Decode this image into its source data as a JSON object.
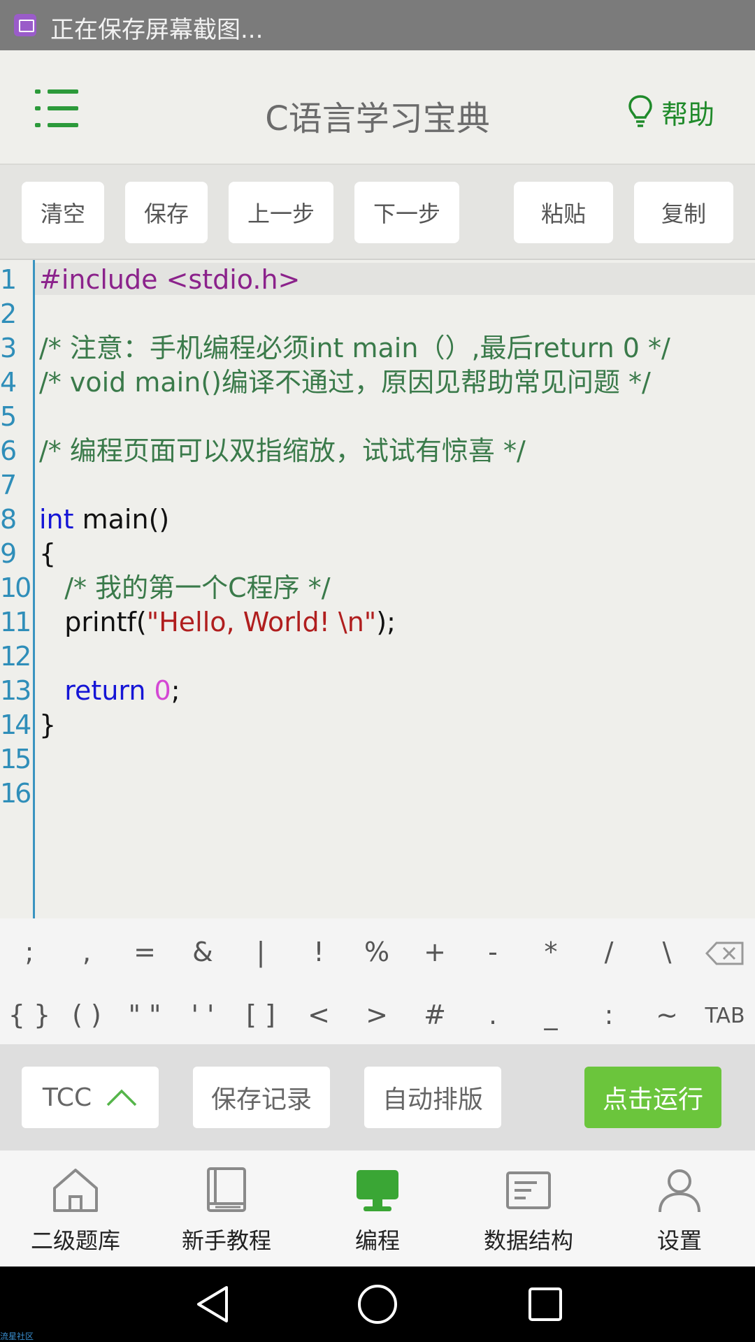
{
  "status_bar": {
    "notification": "正在保存屏幕截图..."
  },
  "header": {
    "title": "C语言学习宝典",
    "help_label": "帮助"
  },
  "toolbar": {
    "clear": "清空",
    "save": "保存",
    "undo": "上一步",
    "redo": "下一步",
    "paste": "粘贴",
    "copy": "复制"
  },
  "editor": {
    "line_numbers": [
      "1",
      "2",
      "3",
      "4",
      "5",
      "6",
      "7",
      "8",
      "9",
      "10",
      "11",
      "12",
      "13",
      "14",
      "15",
      "16"
    ],
    "line1": "#include <stdio.h>",
    "line3": "/* 注意：手机编程必须int main（）,最后return 0 */",
    "line4": "/* void main()编译不通过，原因见帮助常见问题 */",
    "line6": "/* 编程页面可以双指缩放，试试有惊喜 */",
    "line8_kw": "int",
    "line8_rest": " main()",
    "line9": "{",
    "line10_indent": "   ",
    "line10": "/* 我的第一个C程序 */",
    "line11_fn": "   printf(",
    "line11_str": "\"Hello, World! \\n\"",
    "line11_end": ");",
    "line13_indent": "   ",
    "line13_kw": "return",
    "line13_sp": " ",
    "line13_num": "0",
    "line13_end": ";",
    "line14": "}"
  },
  "symbol_keys": {
    "row1": [
      ";",
      ",",
      "=",
      "&",
      "|",
      "!",
      "%",
      "+",
      "-",
      "*",
      "/",
      "\\"
    ],
    "row2": [
      "{ }",
      "( )",
      "\" \"",
      "' '",
      "[ ]",
      "<",
      ">",
      "#",
      ".",
      "_",
      ":",
      "~",
      "TAB"
    ]
  },
  "actions": {
    "compiler": "TCC",
    "save_history": "保存记录",
    "auto_format": "自动排版",
    "run": "点击运行"
  },
  "bottom_nav": {
    "items": [
      "二级题库",
      "新手教程",
      "编程",
      "数据结构",
      "设置"
    ],
    "active_color": "#3aa635"
  },
  "watermark": "流星社区",
  "colors": {
    "accent": "#2c9a3a",
    "run_button": "#6bc53c",
    "line_number": "#2f8eb9"
  }
}
